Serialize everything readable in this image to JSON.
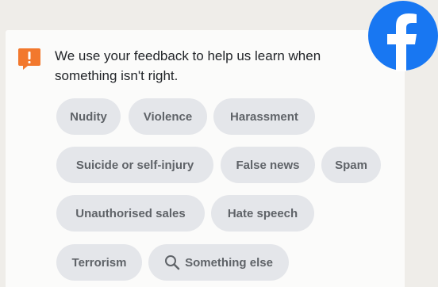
{
  "notice": {
    "icon": "alert-speech-bubble-icon",
    "icon_color": "#f2782d",
    "message": "We use your feedback to help us learn when something isn't right."
  },
  "categories": [
    {
      "label": "Nudity"
    },
    {
      "label": "Violence"
    },
    {
      "label": "Harassment"
    },
    {
      "label": "Suicide or self-injury"
    },
    {
      "label": "False news"
    },
    {
      "label": "Spam"
    },
    {
      "label": "Unauthorised sales"
    },
    {
      "label": "Hate speech"
    },
    {
      "label": "Terrorism"
    },
    {
      "label": "Something else",
      "icon": "search-icon"
    }
  ],
  "brand": {
    "logo": "facebook-logo-icon",
    "color": "#1877f2"
  }
}
